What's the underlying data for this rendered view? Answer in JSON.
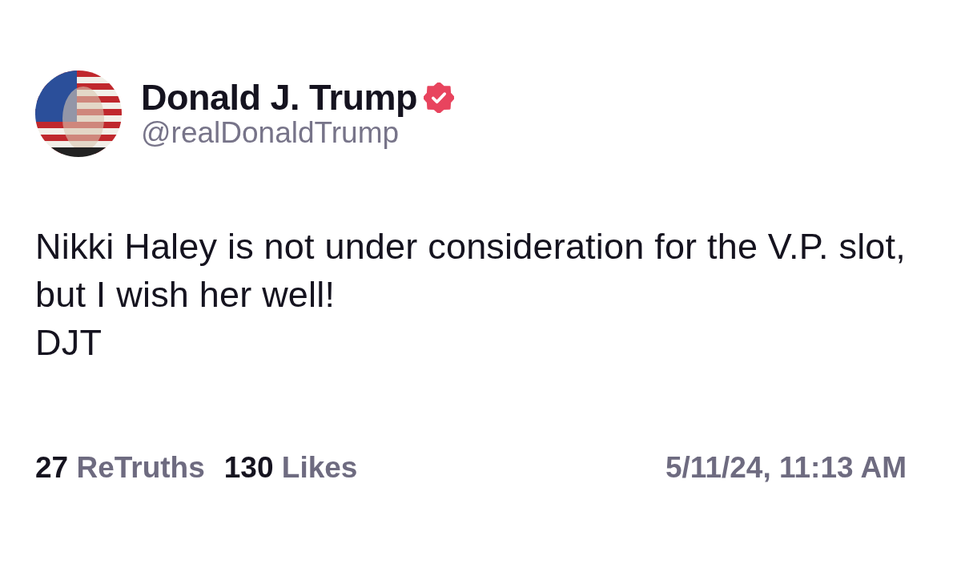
{
  "author": {
    "name": "Donald J. Trump",
    "handle": "@realDonaldTrump",
    "verified": true
  },
  "post": {
    "text": "Nikki Haley is not under consideration for the V.P. slot, but I wish her well!\nDJT"
  },
  "stats": [
    {
      "count": "27",
      "label": "ReTruths"
    },
    {
      "count": "130",
      "label": "Likes"
    }
  ],
  "timestamp": "5/11/24, 11:13 AM"
}
